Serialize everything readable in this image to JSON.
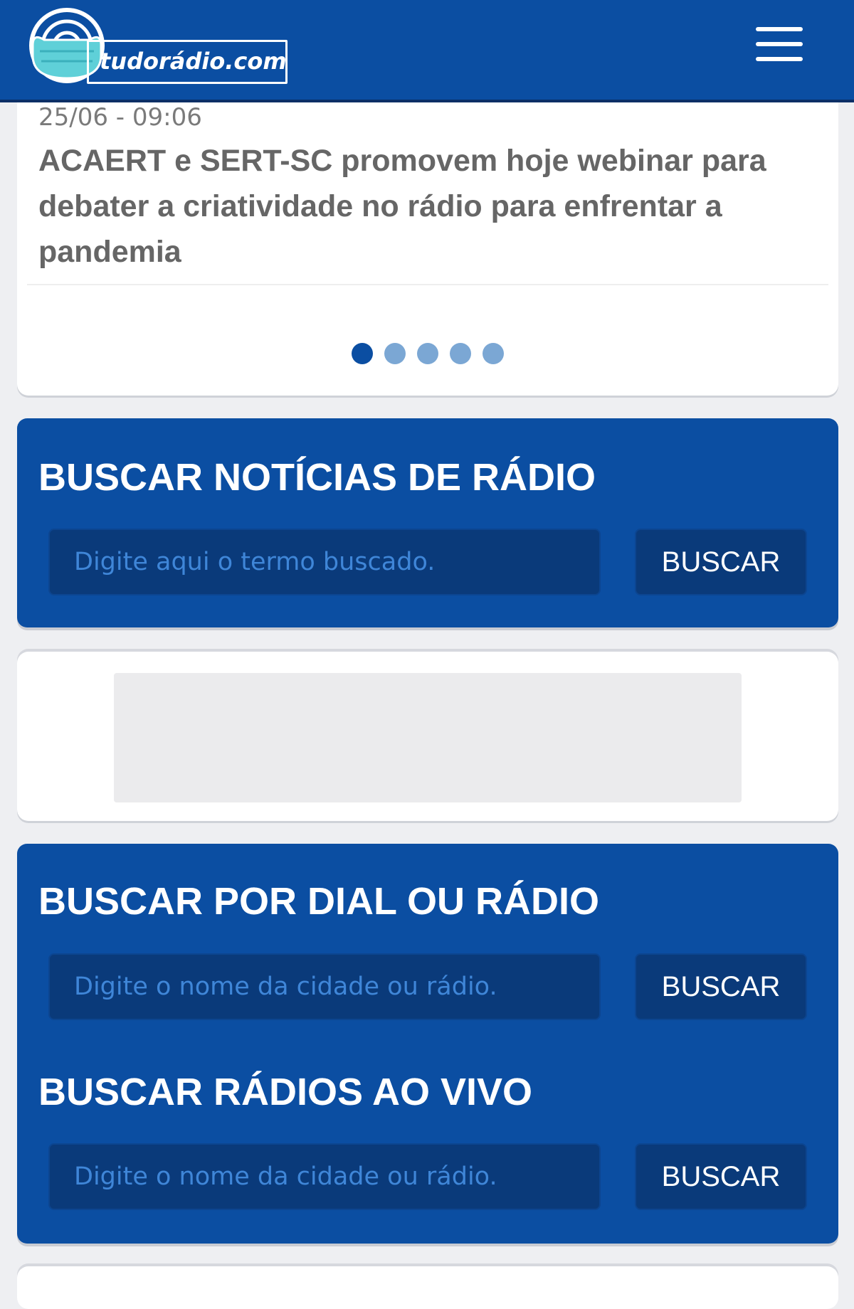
{
  "header": {
    "logo_text": "tudorádio.com",
    "menu_icon": "hamburger-menu-icon",
    "background_color": "#0b4ea2"
  },
  "news": {
    "date": "25/06 - 09:06",
    "title": "ACAERT e SERT-SC promovem hoje webinar para debater a criatividade no rádio para enfrentar a pandemia",
    "carousel_total": 5,
    "carousel_active_index": 0
  },
  "search_news": {
    "title": "BUSCAR NOTÍCIAS DE RÁDIO",
    "placeholder": "Digite aqui o termo buscado.",
    "button_label": "BUSCAR"
  },
  "search_dial": {
    "title": "BUSCAR POR DIAL OU RÁDIO",
    "placeholder": "Digite o nome da cidade ou rádio.",
    "button_label": "BUSCAR"
  },
  "search_live": {
    "title": "BUSCAR RÁDIOS AO VIVO",
    "placeholder": "Digite o nome da cidade ou rádio.",
    "button_label": "BUSCAR"
  },
  "colors": {
    "brand_blue": "#0b4ea2",
    "input_dark_blue": "#0a3a7a",
    "placeholder_blue": "#3f86d8",
    "carousel_dot_inactive": "#7ba7d4"
  }
}
